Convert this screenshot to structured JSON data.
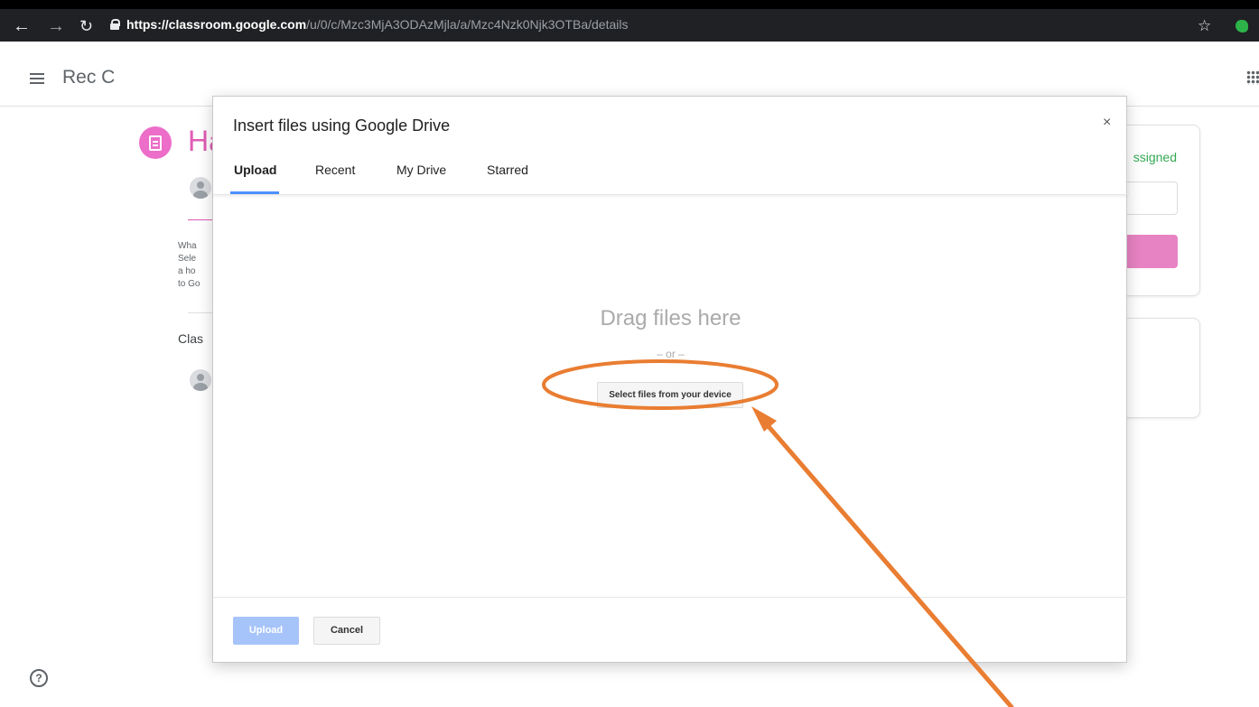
{
  "browser": {
    "back_icon": "arrow-left-icon",
    "forward_icon": "arrow-right-icon",
    "reload_icon": "reload-icon",
    "url_scheme": "https://",
    "url_host": "classroom.google.com",
    "url_path": "/u/0/c/Mzc3MjA3ODAzMjla/a/Mzc4Nzk0Njk3OTBa/details",
    "bookmark_icon": "star-icon",
    "extension_icon": "evernote-icon"
  },
  "app": {
    "class_name": "Rec C",
    "assignment_title_partial": "Ha",
    "description_partial": [
      "Wha",
      "Sele",
      "a ho",
      "to Go"
    ],
    "class_comments_partial": "Clas",
    "status_partial": "ssigned"
  },
  "picker": {
    "title": "Insert files using Google Drive",
    "close_label": "×",
    "tabs": [
      {
        "label": "Upload",
        "active": true
      },
      {
        "label": "Recent",
        "active": false
      },
      {
        "label": "My Drive",
        "active": false
      },
      {
        "label": "Starred",
        "active": false
      }
    ],
    "drag_text": "Drag files here",
    "or_text": "– or –",
    "select_button": "Select files from your device",
    "upload_button": "Upload",
    "cancel_button": "Cancel"
  },
  "colors": {
    "accent_pink": "#ec6ec9",
    "tab_underline": "#4d90fe",
    "upload_disabled": "#a7c4fa",
    "annotation_orange": "#e97d32",
    "status_green": "#34a853"
  }
}
